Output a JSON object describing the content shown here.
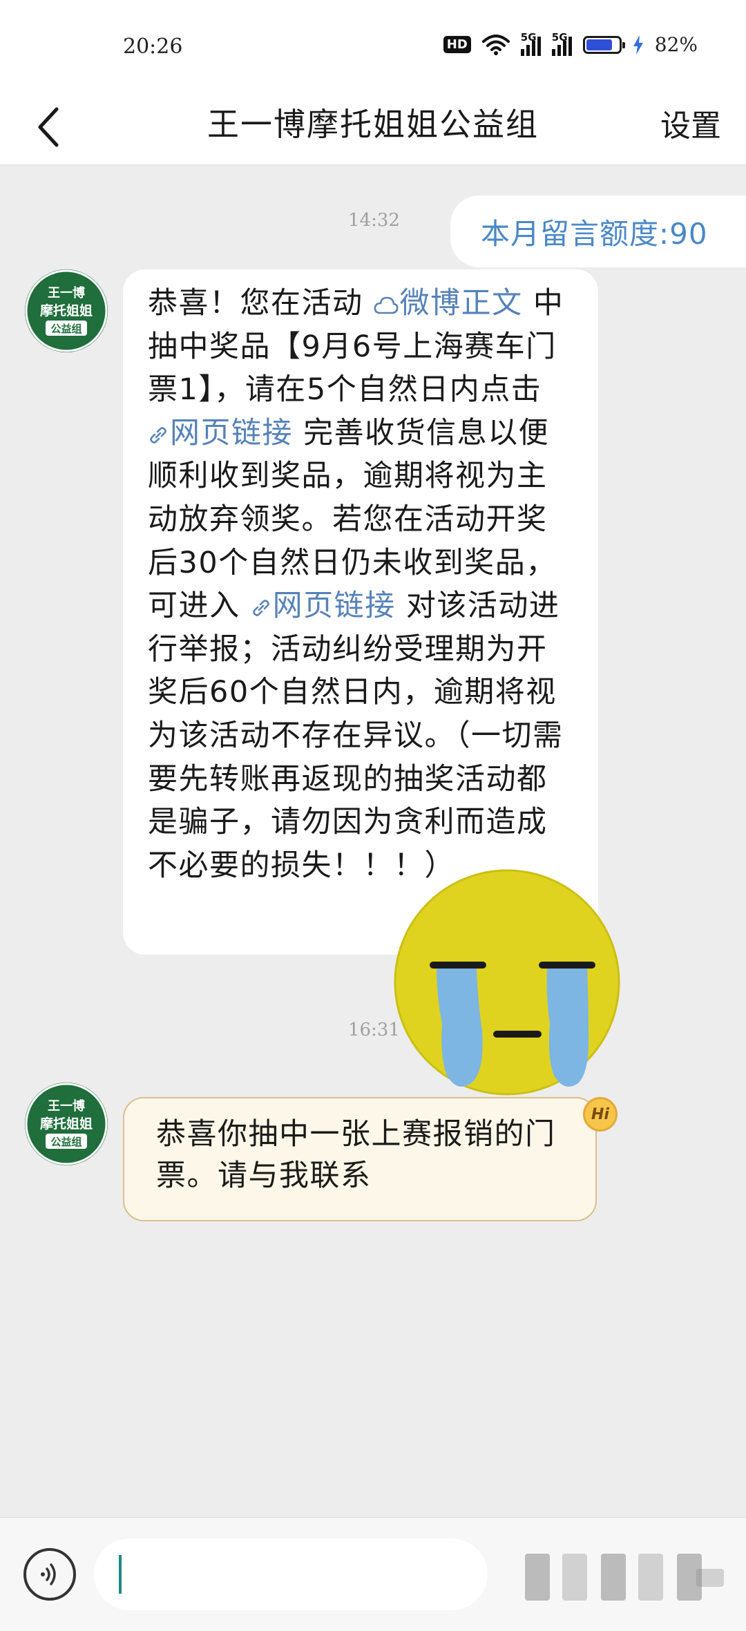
{
  "status_bar": {
    "time": "20:26",
    "hd_badge": "HD",
    "network_1": "5G",
    "network_2": "5G",
    "battery_percent": "82%",
    "battery_level": 0.82,
    "icons": [
      "wifi-icon",
      "signal-icon",
      "signal-icon",
      "battery-icon",
      "charging-icon"
    ]
  },
  "header": {
    "title": "王一博摩托姐姐公益组",
    "settings_label": "设置",
    "back_icon": "chevron-left-icon"
  },
  "messages": {
    "time_1": "14:32",
    "quota_text": "本月留言额度:90",
    "avatar_text": [
      "王一博",
      "摩托姐姐",
      "公益组"
    ],
    "msg1": {
      "part1": "恭喜！您在活动 ",
      "link_weibo": "微博正文",
      "part2": " 中抽中奖品【9月6号上海赛车门票1】，请在5个自然日内点击 ",
      "link_web_1": "网页链接",
      "part3": " 完善收货信息以便顺利收到奖品，逾期将视为主动放弃领奖。若您在活动开奖后30个自然日仍未收到奖品，可进入 ",
      "link_web_2": "网页链接",
      "part4": " 对该活动进行举报；活动纠纷受理期为开奖后60个自然日内，逾期将视为该活动不存在异议。（一切需要先转账再返现的抽奖活动都是骗子，请勿因为贪利而造成不必要的损失！！！）"
    },
    "time_2": "16:31",
    "msg2": "恭喜你抽中一张上赛报销的门票。请与我联系",
    "hi_badge": "Hi",
    "sticker": "crying-emoji"
  },
  "bottom_bar": {
    "voice_icon": "voice-icon",
    "input_value": ""
  }
}
